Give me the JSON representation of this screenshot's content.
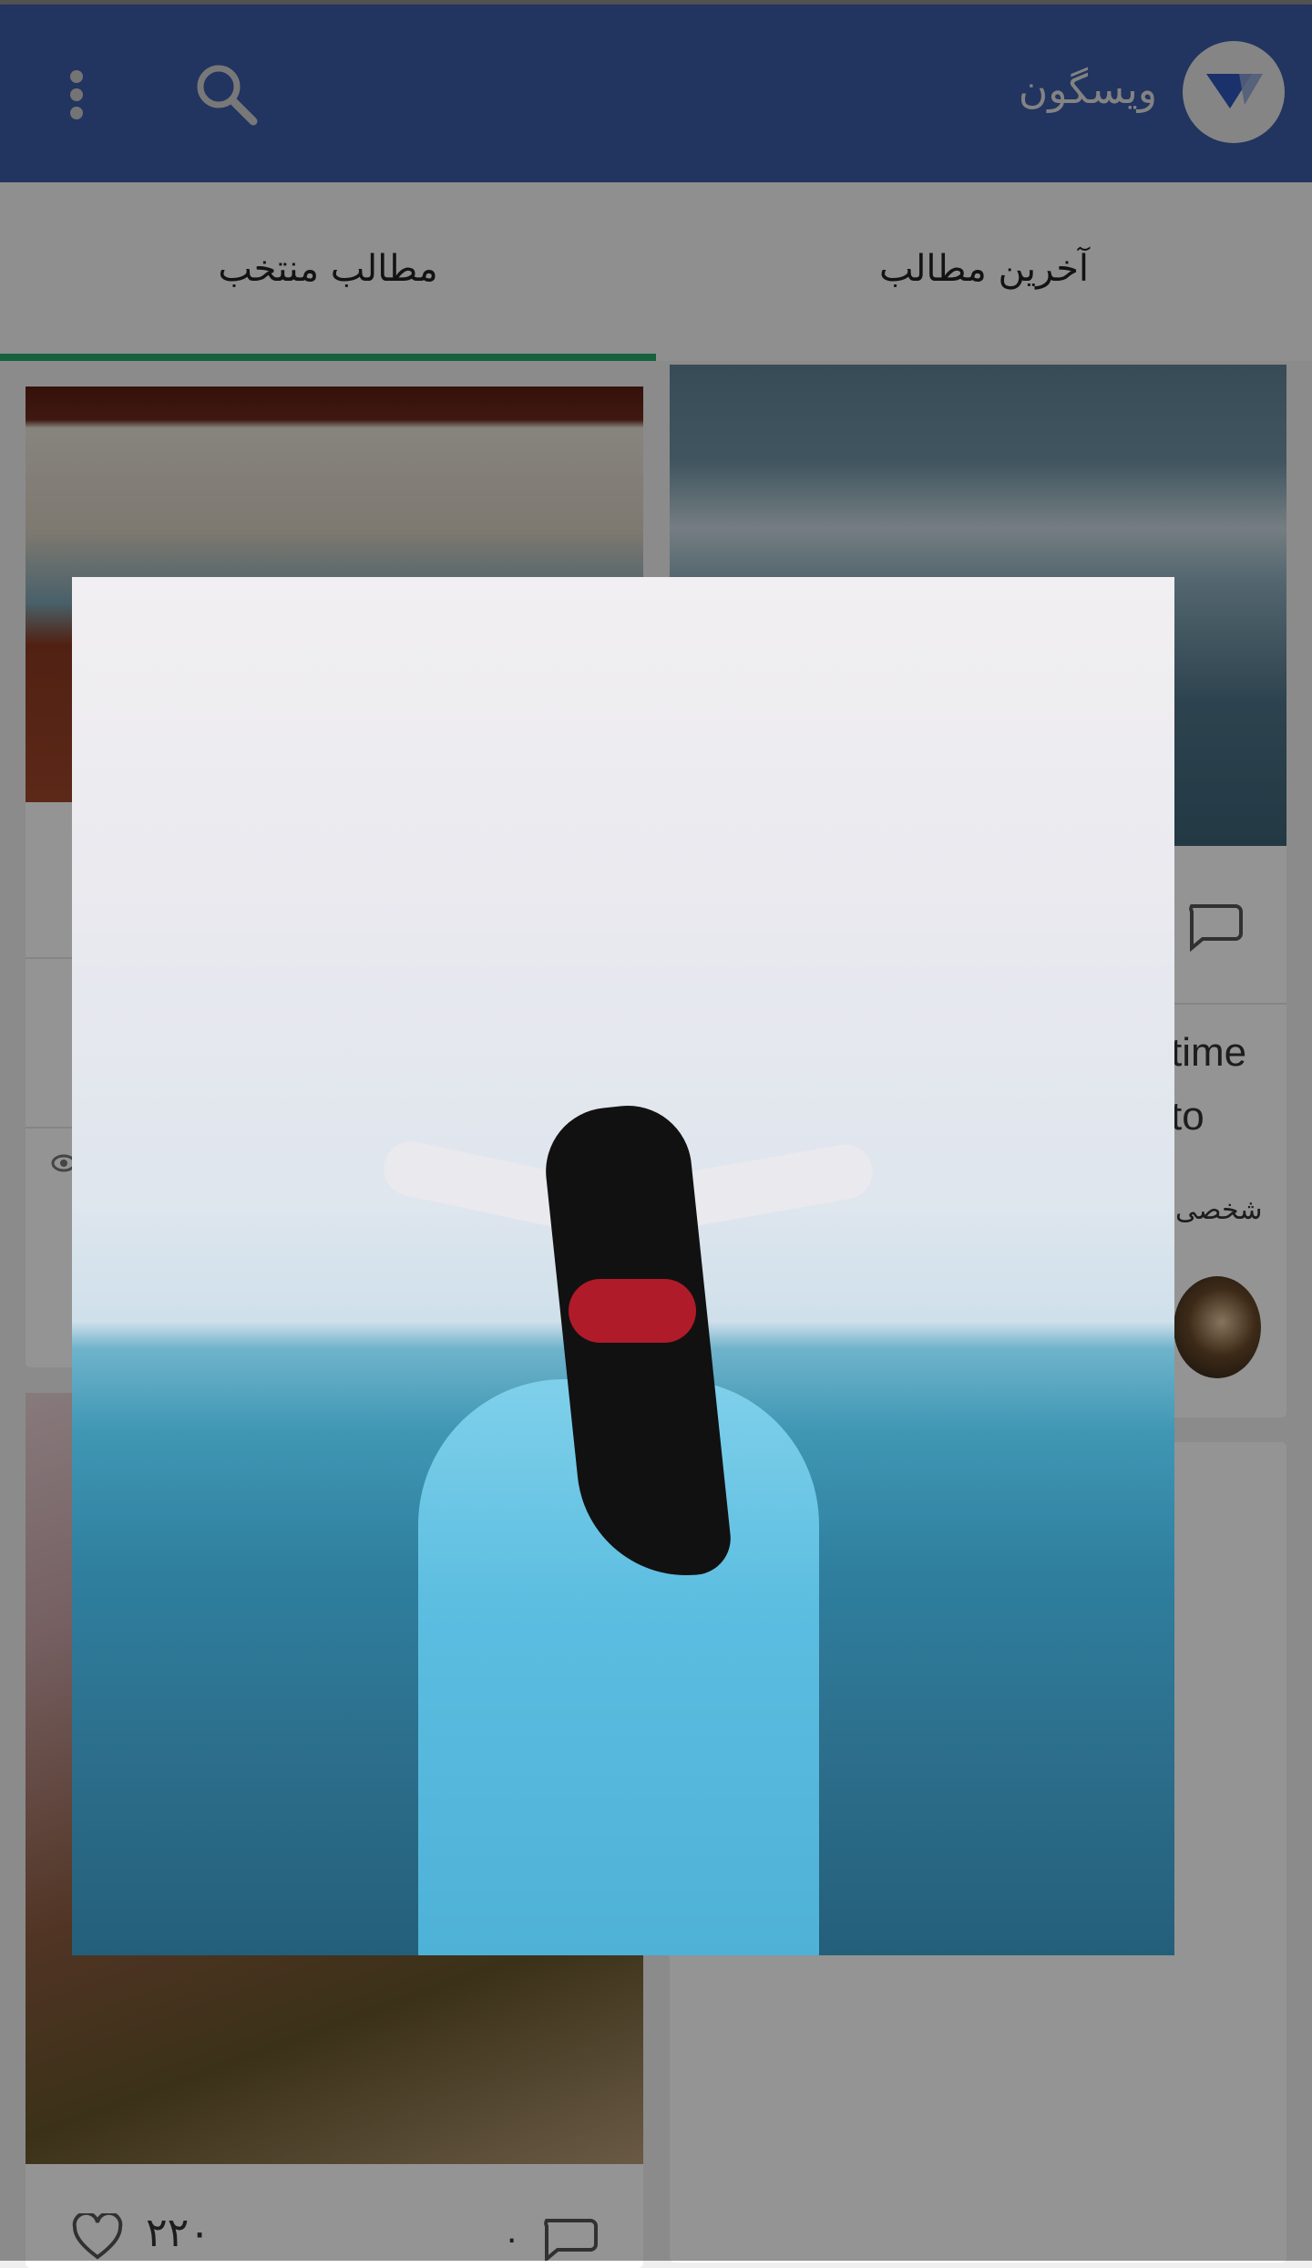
{
  "appbar": {
    "title": "ویسگون",
    "logo_icon": "visgoon-logo-icon",
    "search_icon": "search-icon",
    "menu_icon": "more-vert-icon",
    "color": "#3b5aa6"
  },
  "tabs": [
    {
      "label": "آخرین مطالب",
      "active": false
    },
    {
      "label": "مطالب منتخب",
      "active": true
    }
  ],
  "accent_color": "#26a96c",
  "cards": {
    "right_top": {
      "snippet_line1": "time",
      "snippet_line2": "to",
      "author_fragment": "شخصی"
    },
    "left_bottom": {
      "likes": "۲۲۰",
      "comments": "۰"
    }
  }
}
